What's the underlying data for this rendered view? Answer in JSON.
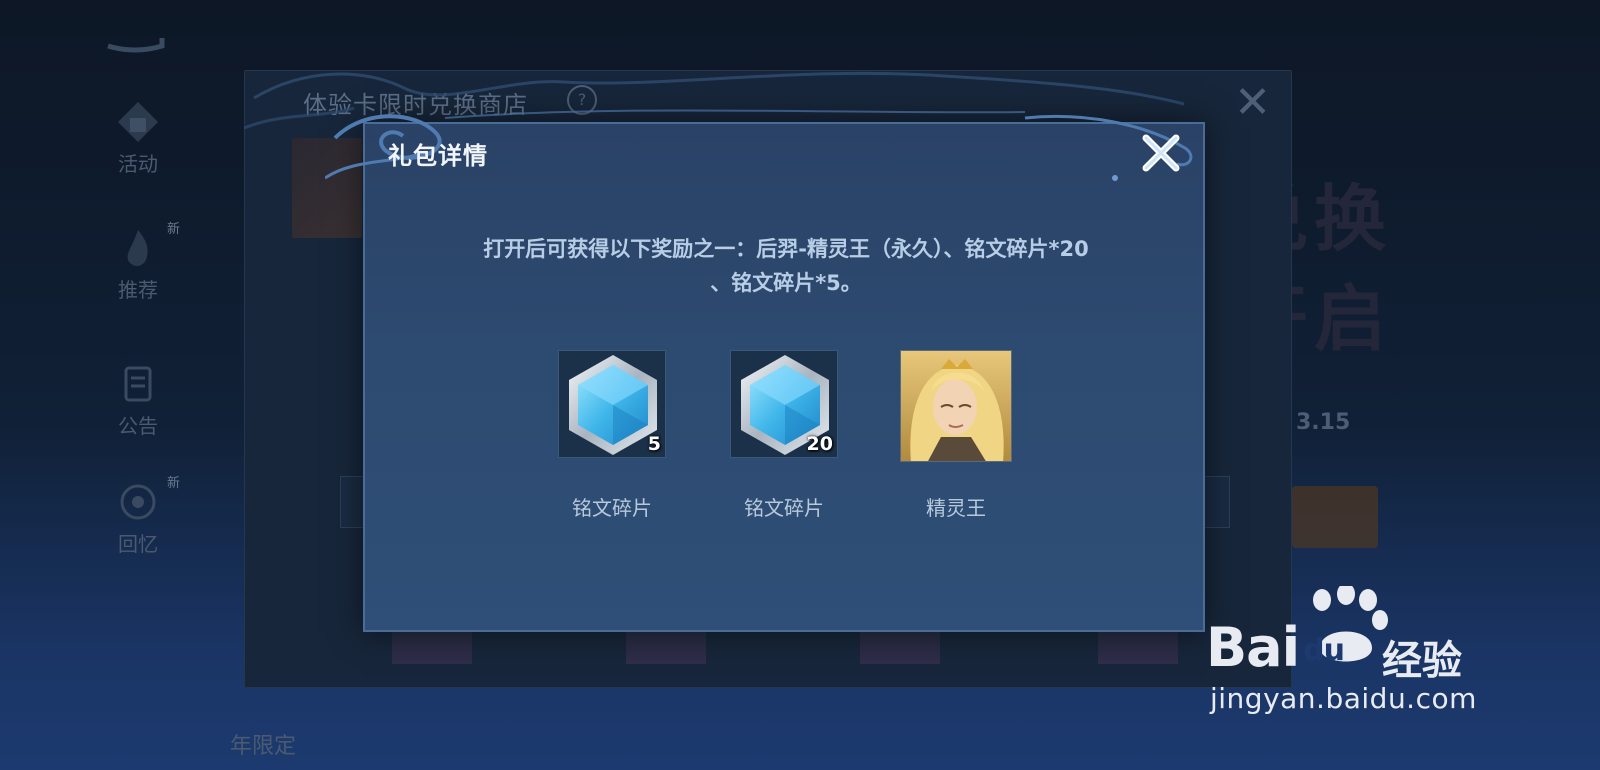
{
  "background": {
    "shop_title": "体验卡限时兑换商店",
    "help_glyph": "?",
    "close_glyph": "✕",
    "nav": [
      {
        "label": "活动",
        "badge": ""
      },
      {
        "label": "推荐",
        "badge": "新"
      },
      {
        "label": "公告",
        "badge": ""
      },
      {
        "label": "回忆",
        "badge": "新"
      }
    ],
    "big_text": [
      "兑换",
      "开启"
    ],
    "date_fragment": "3.15",
    "footer_label": "年限定"
  },
  "modal": {
    "title": "礼包详情",
    "close_glyph": "✕",
    "description_line1": "打开后可获得以下奖励之一：后羿-精灵王（永久）、铭文碎片*20",
    "description_line2": "、铭文碎片*5。",
    "rewards": [
      {
        "label": "铭文碎片",
        "quantity": "5",
        "icon": "crystal-hexagon-icon"
      },
      {
        "label": "铭文碎片",
        "quantity": "20",
        "icon": "crystal-hexagon-icon"
      },
      {
        "label": "精灵王",
        "quantity": "",
        "icon": "hero-skin-portrait"
      }
    ]
  },
  "watermark": {
    "brand": "Bai",
    "brand_du": "du",
    "product": "经验",
    "url": "jingyan.baidu.com"
  },
  "colors": {
    "modal_bg": "#2d4a70",
    "modal_border": "#4a6d98",
    "title_text": "#f2f6fb",
    "desc_text": "#b8cde6",
    "crystal": "#4fc3ee"
  }
}
